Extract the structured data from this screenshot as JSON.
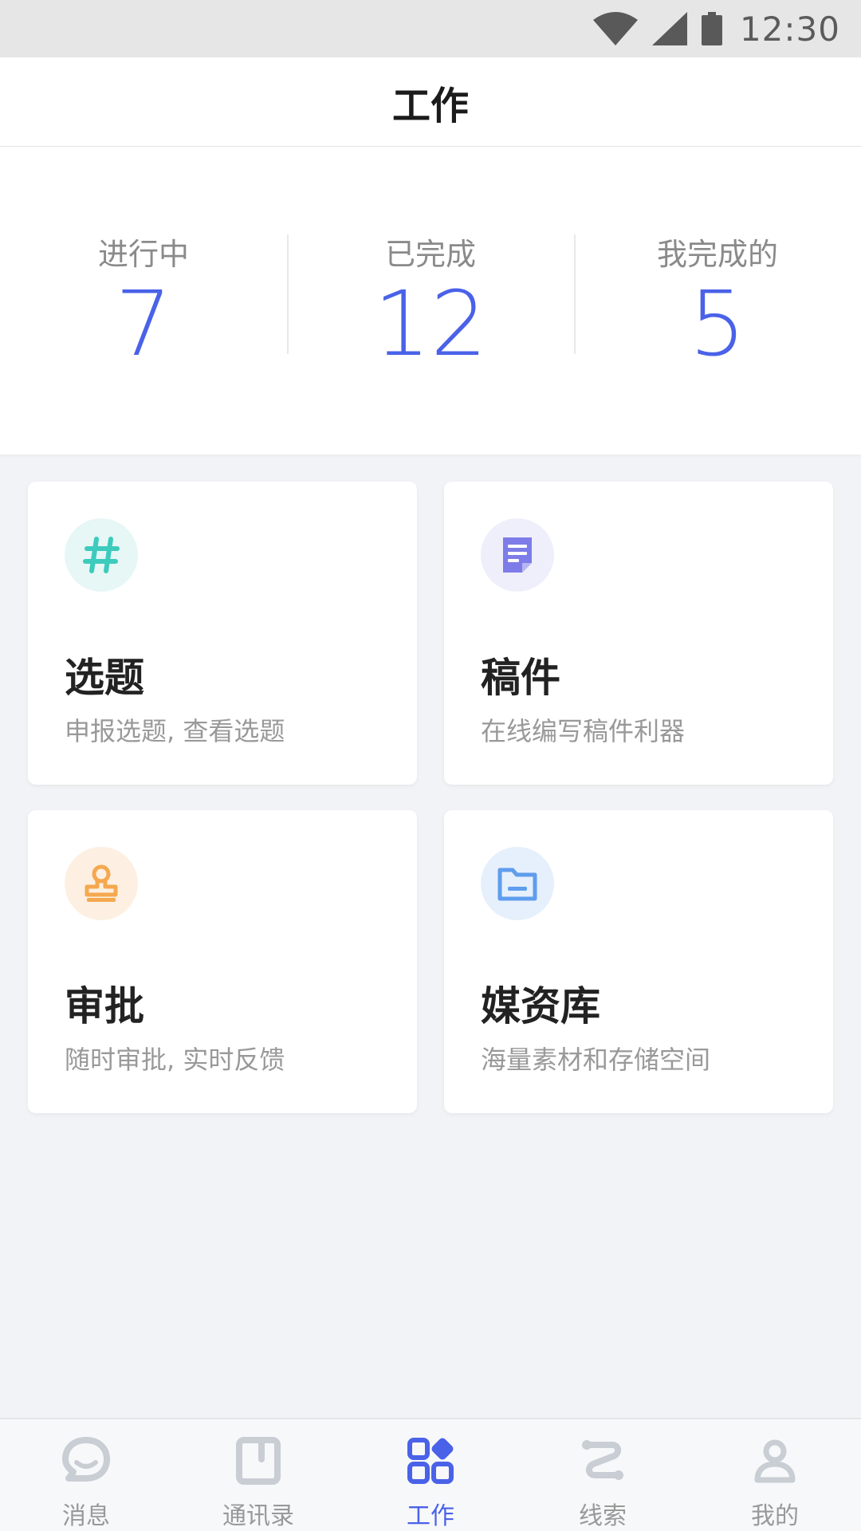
{
  "status_bar": {
    "time": "12:30"
  },
  "header": {
    "title": "工作"
  },
  "stats": [
    {
      "label": "进行中",
      "value": "7"
    },
    {
      "label": "已完成",
      "value": "12"
    },
    {
      "label": "我完成的",
      "value": "5"
    }
  ],
  "cards": [
    {
      "title": "选题",
      "desc": "申报选题, 查看选题",
      "icon": "hash-icon",
      "color": "#3ccbbd",
      "bg": "#e6f7f5"
    },
    {
      "title": "稿件",
      "desc": "在线编写稿件利器",
      "icon": "document-icon",
      "color": "#7d7ce8",
      "bg": "#efeffc"
    },
    {
      "title": "审批",
      "desc": "随时审批, 实时反馈",
      "icon": "stamp-icon",
      "color": "#f5a84f",
      "bg": "#fdf0e2"
    },
    {
      "title": "媒资库",
      "desc": "海量素材和存储空间",
      "icon": "folder-icon",
      "color": "#5f9ded",
      "bg": "#e6f0fc"
    }
  ],
  "nav": [
    {
      "label": "消息",
      "icon": "message-icon"
    },
    {
      "label": "通讯录",
      "icon": "contacts-icon"
    },
    {
      "label": "工作",
      "icon": "work-grid-icon",
      "active": true
    },
    {
      "label": "线索",
      "icon": "route-icon"
    },
    {
      "label": "我的",
      "icon": "profile-icon"
    }
  ],
  "colors": {
    "accent": "#4a62e8",
    "inactive": "#c9cdd4"
  }
}
